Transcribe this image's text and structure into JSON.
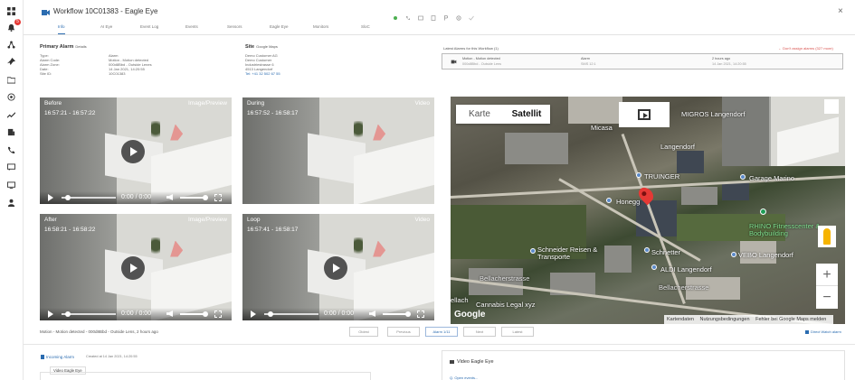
{
  "header": {
    "title": "Workflow 10C01383 - Eagle Eye",
    "close_label": "×"
  },
  "tabs": [
    {
      "label": "Info"
    },
    {
      "label": "AI Eye"
    },
    {
      "label": "Event Log"
    },
    {
      "label": "Events"
    },
    {
      "label": "Sensors"
    },
    {
      "label": "Eagle Eye"
    },
    {
      "label": "Monitors"
    },
    {
      "label": "SloC"
    }
  ],
  "primary_alarm": {
    "title": "Primary Alarm",
    "title_suffix": "Details",
    "labels": [
      "Type:",
      "Alarm Code:",
      "Alarm Zone:",
      "Date:",
      "Site ID:"
    ],
    "values": [
      "Alarm",
      "Motion - Motion detected",
      "000d8Bbd - Outside Lenes",
      "14 Jan 2021, 14:20:55",
      "10C01383"
    ]
  },
  "site": {
    "title": "Site",
    "title_suffix": "Google Maps",
    "lines": [
      "Demo Customer AG",
      "Demo Customer",
      "Industriestrasse 6",
      "4513 Langendorf"
    ],
    "phone": "Tel: +41 32 502 67 55"
  },
  "latest": {
    "title": "Latest Alarms for this Workflow (1)",
    "link": "← Don't assign alarms (327 more)",
    "row1": [
      "Motion - Motion detected",
      "Alarm",
      "2 hours ago"
    ],
    "row2": [
      "000d8Bbd - Outside Lens",
      "SMS 12:1",
      "14 Jan 2021, 14:20:55"
    ]
  },
  "videos": [
    {
      "label": "Before",
      "time": "16:57:21 - 16:57:22",
      "right_label": "Image/Preview",
      "counter": "0:00 / 0:00"
    },
    {
      "label": "During",
      "time": "16:57:52 - 16:58:17",
      "right_label": "Video",
      "counter": "0:00 / 0:00"
    },
    {
      "label": "After",
      "time": "16:58:21 - 16:58:22",
      "right_label": "Image/Preview",
      "counter": "0:00 / 0:00"
    },
    {
      "label": "Loop",
      "time": "16:57:41 - 16:58:17",
      "right_label": "Video",
      "counter": "0:00 / 0:00"
    }
  ],
  "map": {
    "type_map": "Karte",
    "type_satellite": "Satellit",
    "labels": [
      "Micasa",
      "Langendorf",
      "TRUINGER",
      "Honegg",
      "Garage Marino",
      "RHINO Fitnesscenter & Bodybuilding",
      "Schneider Reisen & Transporte",
      "Schnetter",
      "ALDI Langendorf",
      "VEBO Langendorf",
      "Bellacherstrasse",
      "Bellacherstrasse",
      "ellach",
      "Cannabis Legal xyz",
      "MIGROS Langendorf"
    ],
    "google": "Google",
    "attribution": [
      "Kartendaten",
      "Nutzungsbedingungen",
      "Fehler bei Google Maps melden"
    ],
    "zoom_in": "+",
    "zoom_out": "−"
  },
  "pager": {
    "status": "Motion - Motion detected - 000d8Bbd - Outside Lens, 2 hours ago",
    "first": "Oldest",
    "prev": "Previous",
    "current": "Alarm 1/11",
    "next": "Next",
    "last": "Latest",
    "direct": "Direct Watch alarm"
  },
  "bottom": {
    "incoming_link": "Incoming Alarm",
    "incoming_date": "Created at 14 Jan 2021, 14:20:55",
    "sub_tab": "Video Eagle Eye",
    "right_title": "Video Eagle Eye",
    "right_sub": "Q. Open events..."
  },
  "colors": {
    "accent": "#2b6cb0",
    "danger": "#e53935",
    "map_pin": "#e53935",
    "pegman": "#f6b400"
  }
}
